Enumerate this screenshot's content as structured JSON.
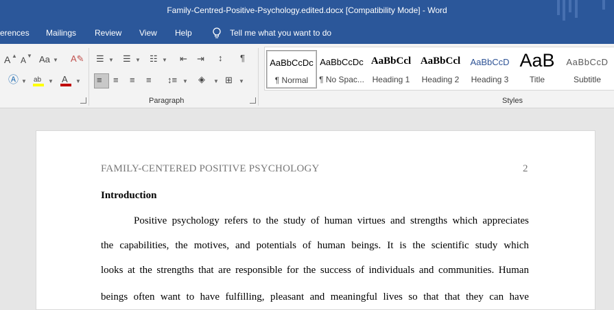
{
  "window": {
    "title": "Family-Centred-Positive-Psychology.edited.docx [Compatibility Mode]  -  Word"
  },
  "menu": {
    "references": "erences",
    "mailings": "Mailings",
    "review": "Review",
    "view": "View",
    "help": "Help",
    "tell_me": "Tell me what you want to do"
  },
  "ribbon": {
    "paragraph_label": "Paragraph",
    "styles_label": "Styles",
    "font_size_icons": [
      "A",
      "A"
    ],
    "case_icon": "Aa",
    "styles": [
      {
        "preview": "AaBbCcDc",
        "name": "¶ Normal"
      },
      {
        "preview": "AaBbCcDc",
        "name": "¶ No Spac..."
      },
      {
        "preview": "AaBbCcl",
        "name": "Heading 1"
      },
      {
        "preview": "AaBbCcl",
        "name": "Heading 2"
      },
      {
        "preview": "AaBbCcD",
        "name": "Heading 3"
      },
      {
        "preview": "AaB",
        "name": "Title"
      },
      {
        "preview": "AaBbCcD",
        "name": "Subtitle"
      }
    ],
    "colors": {
      "highlight": "#ffff00",
      "font_color": "#c00000",
      "accent": "#2b579a"
    }
  },
  "document": {
    "header": "FAMILY-CENTERED POSITIVE PSYCHOLOGY",
    "page_number": "2",
    "heading": "Introduction",
    "lines": [
      "Positive psychology refers to the study of human virtues and strengths which appreciates",
      "the capabilities, the motives, and potentials of human beings. It is the scientific study which",
      "looks at the strengths that are responsible for the success of individuals and communities. Human",
      "beings often want to have fulfilling, pleasant and meaningful lives so that that they can have"
    ]
  }
}
